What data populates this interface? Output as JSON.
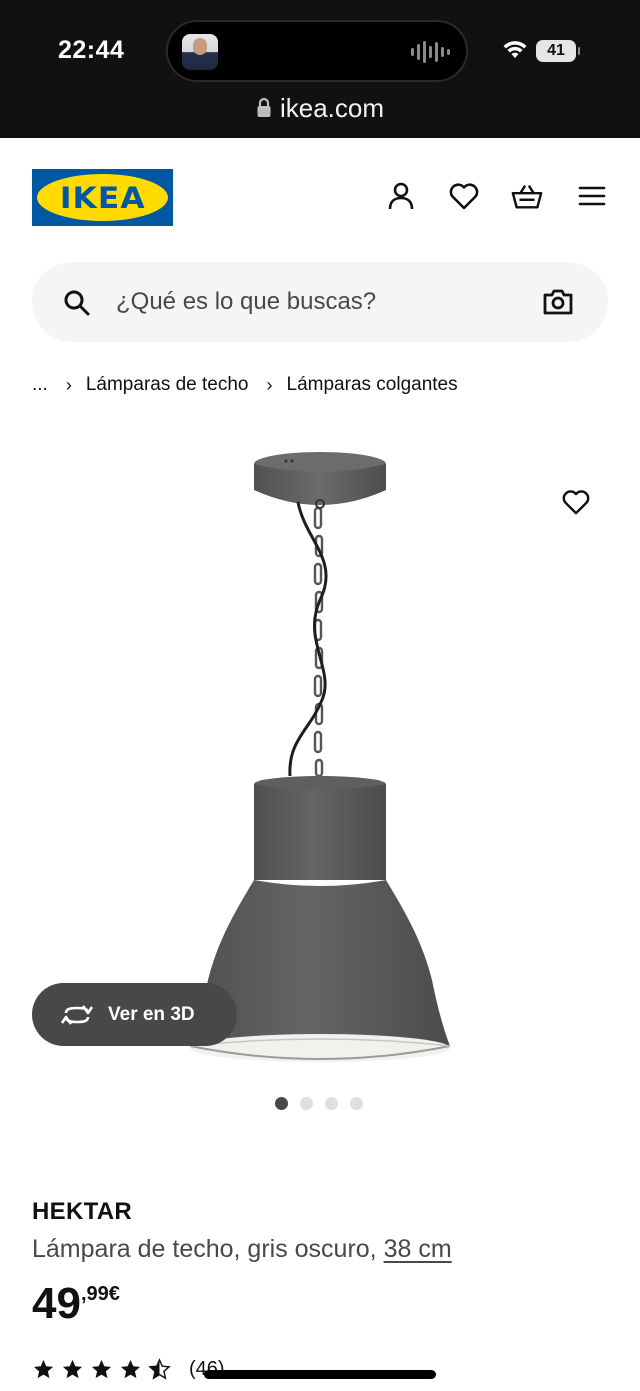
{
  "status_bar": {
    "time": "22:44",
    "battery": "41",
    "url": "ikea.com"
  },
  "header": {
    "logo_text": "IKEA",
    "icons": [
      "user-icon",
      "heart-icon",
      "basket-icon",
      "menu-icon"
    ]
  },
  "search": {
    "placeholder": "¿Qué es lo que buscas?",
    "value": ""
  },
  "breadcrumb": {
    "ellipsis": "...",
    "items": [
      "Lámparas de techo",
      "Lámparas colgantes"
    ]
  },
  "gallery": {
    "view_3d_label": "Ver en 3D",
    "dots_total": 4,
    "active_dot": 1
  },
  "product": {
    "name": "HEKTAR",
    "description": "Lámpara de techo, gris oscuro,",
    "measure": "38 cm",
    "price_integer": "49",
    "price_decimal": ",99",
    "currency": "€",
    "rating_value": 4.5,
    "rating_count": "(46)"
  },
  "colors": {
    "ikea_blue": "#0058a3",
    "ikea_yellow": "#ffdb00",
    "lamp_gray": "#58595a",
    "button_dark": "#484848"
  }
}
